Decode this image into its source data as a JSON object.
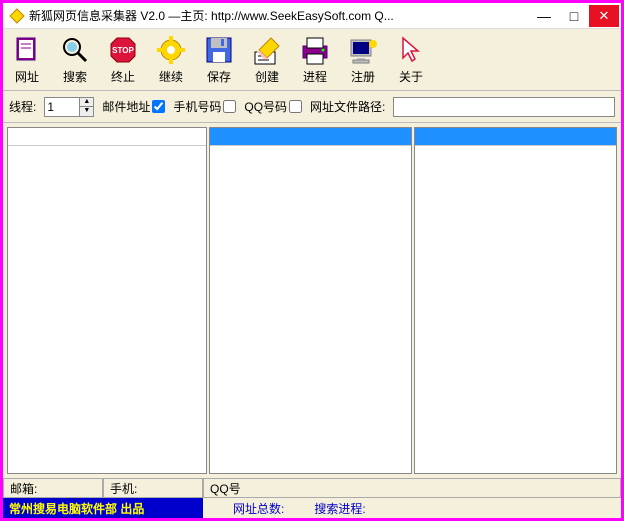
{
  "titlebar": {
    "text": "新狐网页信息采集器 V2.0 —主页: http://www.SeekEasySoft.com Q..."
  },
  "winbtns": {
    "min": "—",
    "max": "□",
    "close": "✕"
  },
  "toolbar": [
    {
      "name": "url-button",
      "icon": "book-icon",
      "label": "网址"
    },
    {
      "name": "search-button",
      "icon": "search-icon",
      "label": "搜索"
    },
    {
      "name": "stop-button",
      "icon": "stop-icon",
      "label": "终止"
    },
    {
      "name": "continue-button",
      "icon": "gear-icon",
      "label": "继续"
    },
    {
      "name": "save-button",
      "icon": "floppy-icon",
      "label": "保存"
    },
    {
      "name": "create-button",
      "icon": "pencil-icon",
      "label": "创建"
    },
    {
      "name": "process-button",
      "icon": "printer-icon",
      "label": "进程"
    },
    {
      "name": "register-button",
      "icon": "computer-icon",
      "label": "注册"
    },
    {
      "name": "about-button",
      "icon": "cursor-icon",
      "label": "关于"
    }
  ],
  "options": {
    "thread_label": "线程:",
    "thread_value": "1",
    "email_label": "邮件地址",
    "email_checked": true,
    "phone_label": "手机号码",
    "phone_checked": false,
    "qq_label": "QQ号码",
    "qq_checked": false,
    "path_label": "网址文件路径:",
    "path_value": ""
  },
  "status1": {
    "mailbox": "邮箱:",
    "phone": "手机:",
    "qq": "QQ号"
  },
  "status2": {
    "brand": "常州搜易电脑软件部  出品",
    "total": "网址总数:",
    "progress": "搜索进程:"
  }
}
